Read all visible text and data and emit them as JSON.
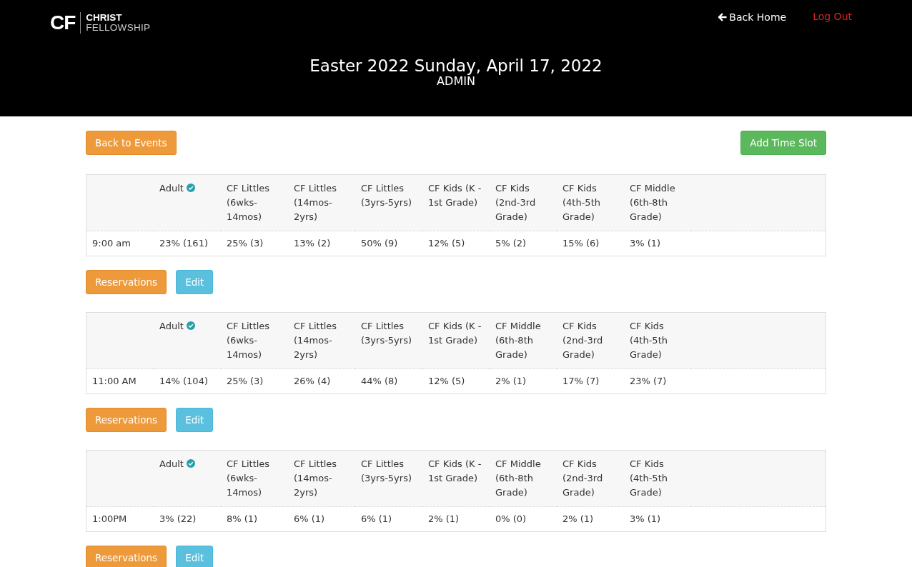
{
  "header": {
    "logo_mark": "CF",
    "logo_line1": "CHRIST",
    "logo_line2": "FELLOWSHIP",
    "back_home": "Back Home",
    "log_out": "Log Out",
    "title": "Easter 2022 Sunday, April 17, 2022",
    "subtitle": "ADMIN"
  },
  "actions": {
    "back": "Back to Events",
    "add": "Add Time Slot"
  },
  "slots": [
    {
      "time": "9:00 am",
      "columns": [
        {
          "label": "Adult",
          "verified": true
        },
        {
          "label": "CF Littles (6wks-14mos)",
          "verified": false
        },
        {
          "label": "CF Littles (14mos-2yrs)",
          "verified": false
        },
        {
          "label": "CF Littles (3yrs-5yrs)",
          "verified": false
        },
        {
          "label": "CF Kids (K - 1st Grade)",
          "verified": false
        },
        {
          "label": "CF Kids (2nd-3rd Grade)",
          "verified": false
        },
        {
          "label": "CF Kids (4th-5th Grade)",
          "verified": false
        },
        {
          "label": "CF Middle (6th-8th Grade)",
          "verified": false
        }
      ],
      "values": [
        "23% (161)",
        "25% (3)",
        "13% (2)",
        "50% (9)",
        "12% (5)",
        "5% (2)",
        "15% (6)",
        "3% (1)"
      ],
      "reservations": "Reservations",
      "edit": "Edit"
    },
    {
      "time": "11:00 AM",
      "columns": [
        {
          "label": "Adult",
          "verified": true
        },
        {
          "label": "CF Littles (6wks-14mos)",
          "verified": false
        },
        {
          "label": "CF Littles (14mos-2yrs)",
          "verified": false
        },
        {
          "label": "CF Littles (3yrs-5yrs)",
          "verified": false
        },
        {
          "label": "CF Kids (K - 1st Grade)",
          "verified": false
        },
        {
          "label": "CF Middle (6th-8th Grade)",
          "verified": false
        },
        {
          "label": "CF Kids (2nd-3rd Grade)",
          "verified": false
        },
        {
          "label": "CF Kids (4th-5th Grade)",
          "verified": false
        }
      ],
      "values": [
        "14% (104)",
        "25% (3)",
        "26% (4)",
        "44% (8)",
        "12% (5)",
        "2% (1)",
        "17% (7)",
        "23% (7)"
      ],
      "reservations": "Reservations",
      "edit": "Edit"
    },
    {
      "time": "1:00PM",
      "columns": [
        {
          "label": "Adult",
          "verified": true
        },
        {
          "label": "CF Littles (6wks-14mos)",
          "verified": false
        },
        {
          "label": "CF Littles (14mos-2yrs)",
          "verified": false
        },
        {
          "label": "CF Littles (3yrs-5yrs)",
          "verified": false
        },
        {
          "label": "CF Kids (K - 1st Grade)",
          "verified": false
        },
        {
          "label": "CF Middle (6th-8th Grade)",
          "verified": false
        },
        {
          "label": "CF Kids (2nd-3rd Grade)",
          "verified": false
        },
        {
          "label": "CF Kids (4th-5th Grade)",
          "verified": false
        }
      ],
      "values": [
        "3% (22)",
        "8% (1)",
        "6% (1)",
        "6% (1)",
        "2% (1)",
        "0% (0)",
        "2% (1)",
        "3% (1)"
      ],
      "reservations": "Reservations",
      "edit": "Edit"
    }
  ]
}
